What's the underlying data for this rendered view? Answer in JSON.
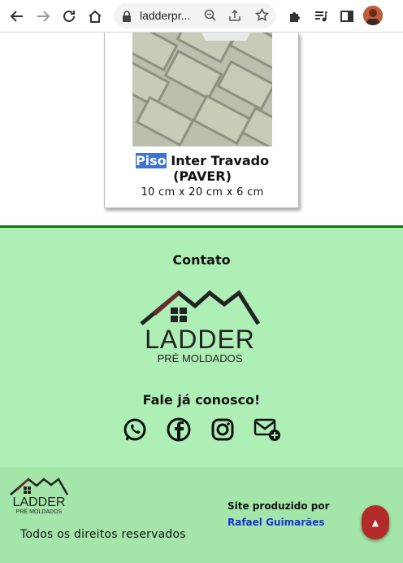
{
  "browser": {
    "url": "ladderpr...",
    "icons": [
      "back-icon",
      "forward-icon",
      "reload-icon",
      "home-icon",
      "lock-icon",
      "zoom-icon",
      "share-icon",
      "bookmark-star-icon",
      "extensions-icon",
      "media-icon",
      "sidepanel-icon",
      "profile-avatar"
    ]
  },
  "product": {
    "title_highlight": "Piso",
    "title_rest": " Inter Travado",
    "title_line2": "(PAVER)",
    "dimensions": "10 cm x 20 cm x 6 cm"
  },
  "contact": {
    "title": "Contato",
    "logo_text": "LADDER",
    "logo_sub": "PRÉ MOLDADOS",
    "cta": "Fale já conosco!",
    "social_icons": [
      "whatsapp-icon",
      "facebook-icon",
      "instagram-icon",
      "email-add-icon"
    ]
  },
  "footer": {
    "logo_text": "LADDER",
    "logo_sub": "PRÉ MOLDADOS",
    "rights": "Todos os direitos reservados",
    "credit_label": "Site produzido por",
    "credit_name": "Rafael Guimarães",
    "top_button": "▲"
  },
  "colors": {
    "contact_bg": "#aeefb6",
    "footer_bg": "#a4e6aa",
    "divider": "#0a7a10",
    "highlight": "#3b73d6",
    "credit_link": "#1a2fd8",
    "top_button": "#b22a2a"
  }
}
